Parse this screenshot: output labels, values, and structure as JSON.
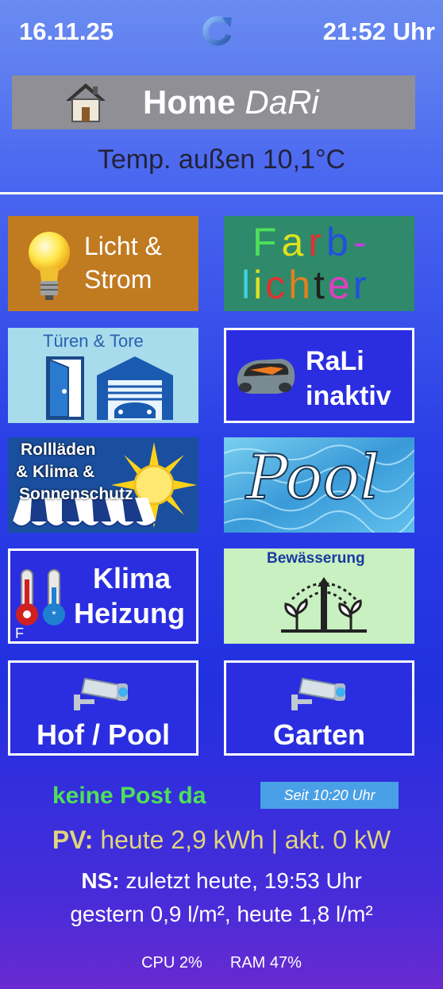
{
  "header": {
    "date": "16.11.25",
    "time": "21:52 Uhr"
  },
  "title": {
    "bold": "Home",
    "italic": "DaRi"
  },
  "temperature": "Temp. außen 10,1°C",
  "tiles": {
    "licht": {
      "line1": "Licht &",
      "line2": "Strom"
    },
    "farb": {
      "line1": "Farb-",
      "line2": "lichter",
      "letters1": [
        "F",
        "a",
        "r",
        "b",
        "-"
      ],
      "letters2": [
        "l",
        "i",
        "c",
        "h",
        "t",
        "e",
        "r"
      ]
    },
    "tueren": {
      "label": "Türen & Tore"
    },
    "rali": {
      "line1": "RaLi",
      "line2": "inaktiv"
    },
    "roll": {
      "line1": "Rollläden",
      "line2": "& Klima &",
      "line3": "Sonnenschutz"
    },
    "pool": {
      "label": "Pool"
    },
    "klima": {
      "line1": "Klima",
      "line2": "Heizung",
      "corner": "F"
    },
    "bewaess": {
      "label": "Bewässerung"
    },
    "hof": {
      "label": "Hof / Pool"
    },
    "garten": {
      "label": "Garten"
    }
  },
  "status": {
    "post": "keine Post da",
    "post_since": "Seit 10:20 Uhr",
    "pv_label": "PV:",
    "pv_text": " heute 2,9 kWh | akt. 0 kW",
    "ns_label": "NS:",
    "ns_text": " zuletzt heute, 19:53 Uhr",
    "ns_line2": "gestern 0,9 l/m², heute 1,8 l/m²",
    "cpu": "CPU 2%",
    "ram": "RAM 47%"
  },
  "colors": {
    "farb_letters1": [
      "#4ee05a",
      "#e0e020",
      "#e03030",
      "#2050e0",
      "#c040e0"
    ],
    "farb_letters2": [
      "#40d0e0",
      "#e0e020",
      "#e03030",
      "#e08020",
      "#202020",
      "#e040c0",
      "#2050e0"
    ]
  }
}
